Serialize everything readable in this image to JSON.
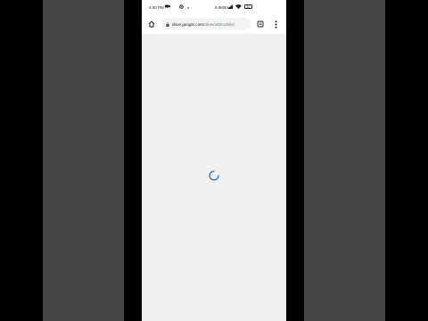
{
  "status_bar": {
    "time": "4:30 PM",
    "network_speed": "9.0KB/s",
    "battery_level": "52",
    "icons": [
      "camera-icon",
      "settings-gear-icon",
      "dot-icon",
      "signal-icon",
      "wifi-icon"
    ]
  },
  "browser": {
    "url_host": "drive.google.com",
    "url_path": "/drive/u/0/mobile/",
    "icons": [
      "home-icon",
      "lock-icon",
      "tab-switcher-icon",
      "more-menu-icon"
    ]
  },
  "page": {
    "state": "loading",
    "spinner_color": "#4a86c8",
    "background": "#f0f0f0"
  }
}
